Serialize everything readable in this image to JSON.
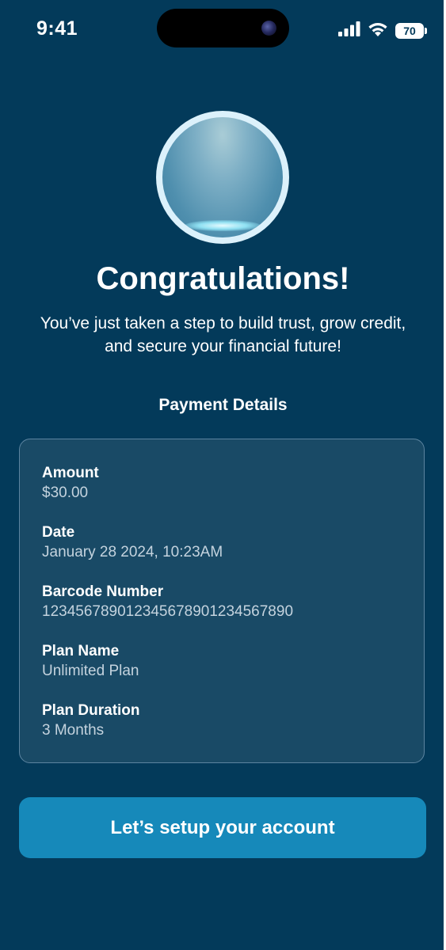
{
  "status_bar": {
    "time": "9:41",
    "battery": "70"
  },
  "colors": {
    "background": "#033a5a",
    "card": "#194a66",
    "button": "#1689ba"
  },
  "main": {
    "title": "Congratulations!",
    "subtitle": "You’ve just taken a step to build trust, grow credit, and secure your financial future!",
    "section_title": "Payment Details",
    "details": [
      {
        "label": "Amount",
        "value": "$30.00"
      },
      {
        "label": "Date",
        "value": "January 28 2024, 10:23AM"
      },
      {
        "label": "Barcode Number",
        "value": "123456789012345678901234567890"
      },
      {
        "label": "Plan Name",
        "value": "Unlimited Plan"
      },
      {
        "label": "Plan Duration",
        "value": "3 Months"
      }
    ],
    "cta_label": "Let’s setup your account"
  },
  "icons": {
    "signal": "cellular-signal-icon",
    "wifi": "wifi-icon",
    "battery": "battery-icon",
    "avatar": "avatar-orb"
  }
}
